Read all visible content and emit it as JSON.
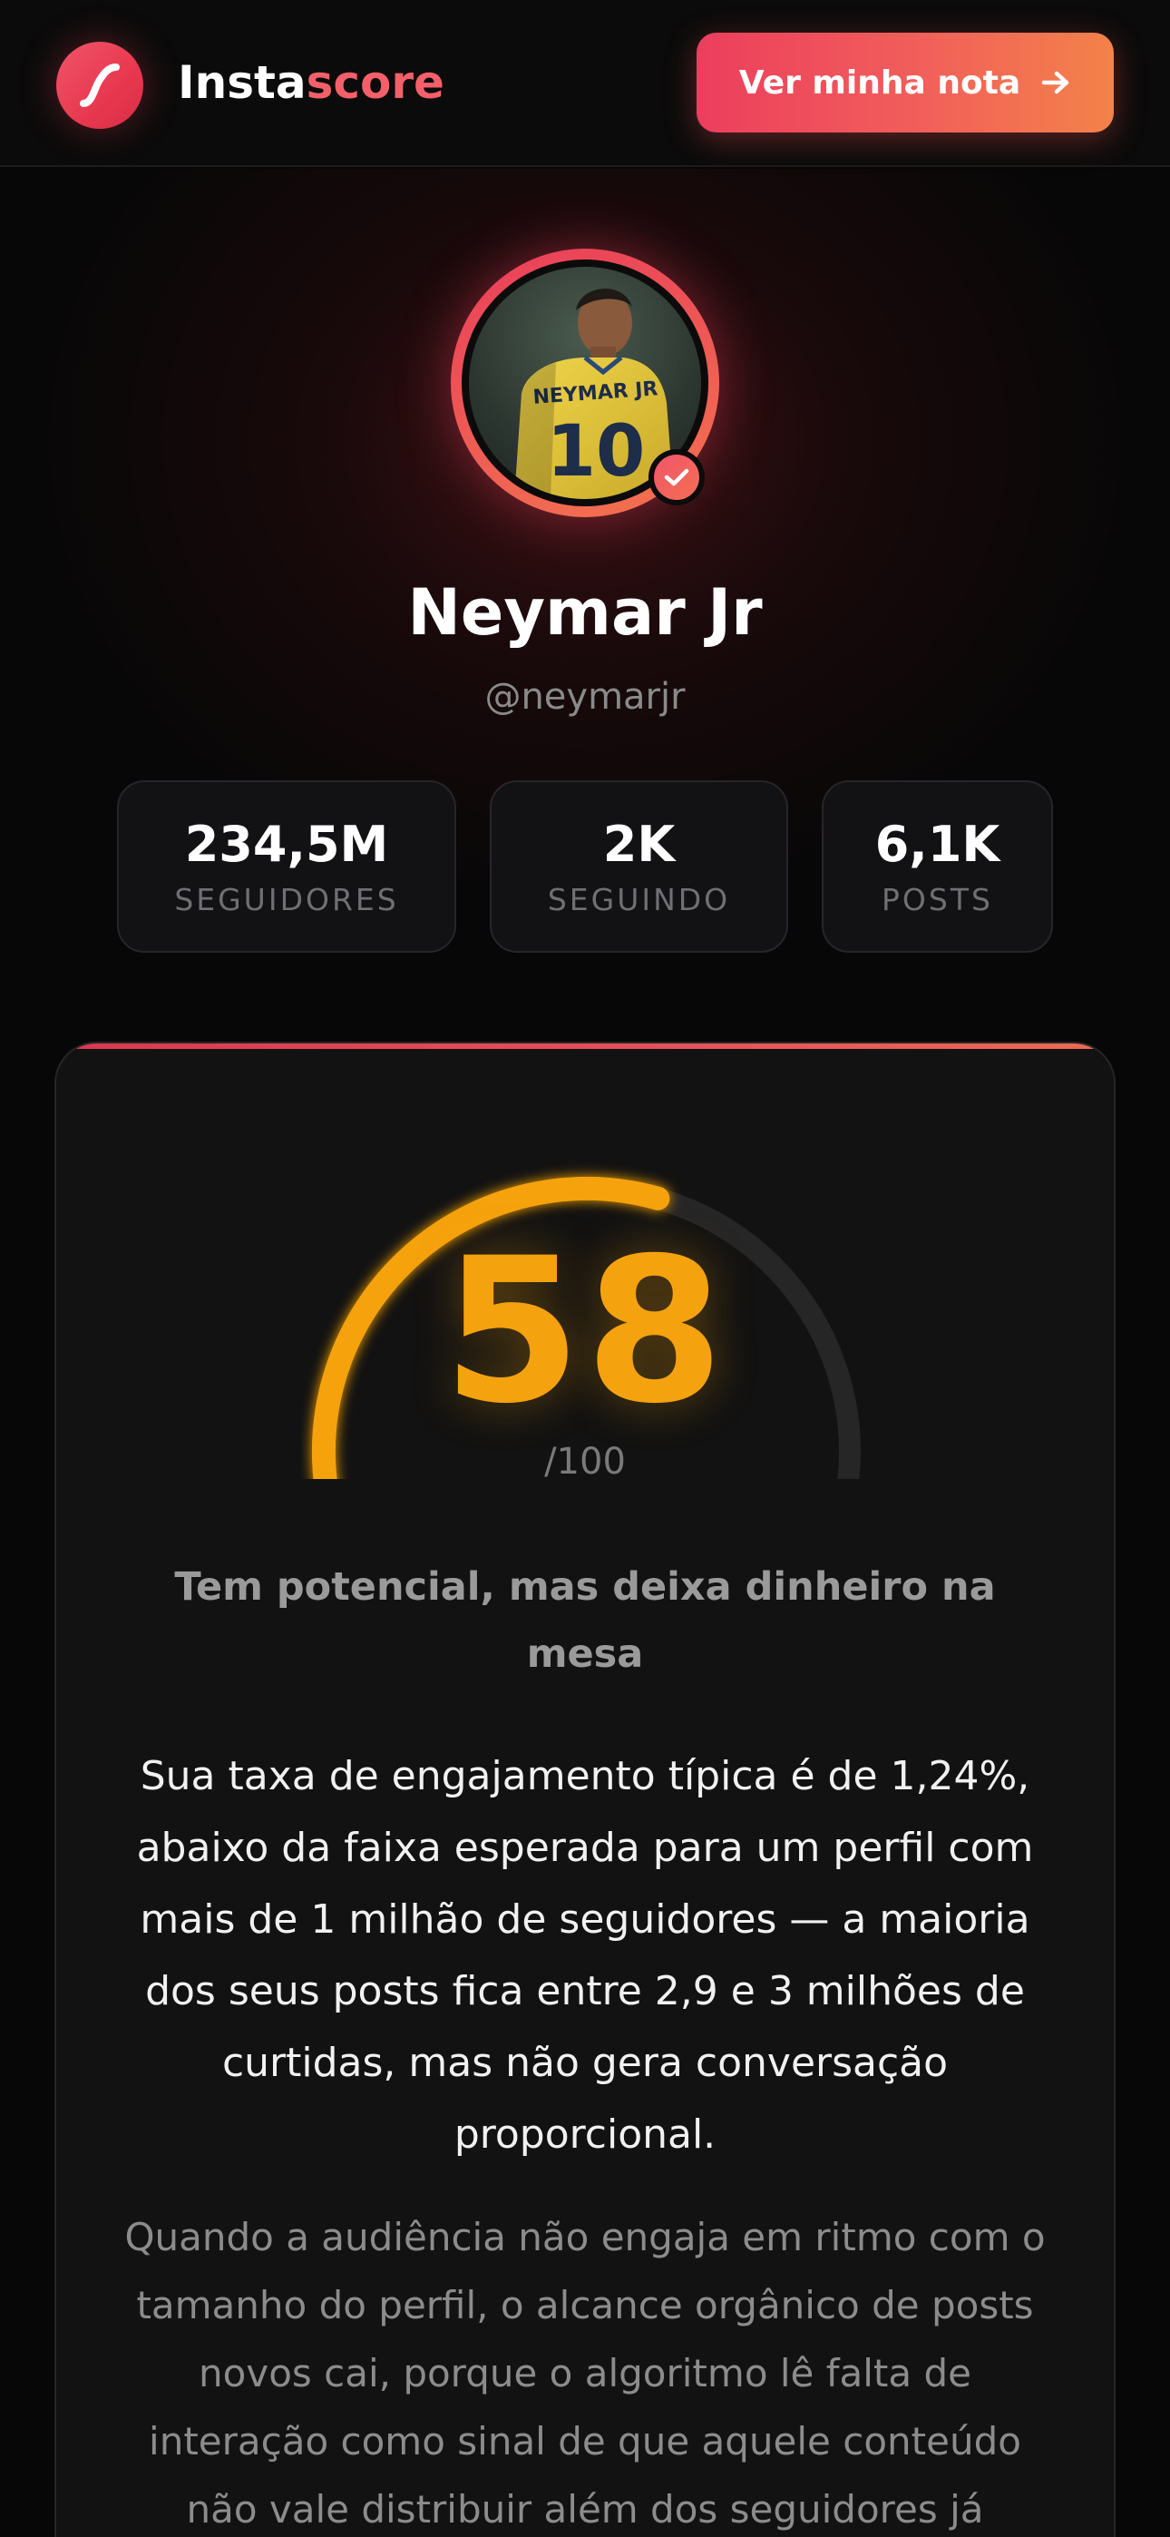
{
  "header": {
    "brand_part1": "Insta",
    "brand_part2": "score",
    "cta_label": "Ver minha nota",
    "logo_icon": "s-curve-logo-icon",
    "cta_icon": "arrow-right-icon"
  },
  "profile": {
    "name": "Neymar Jr",
    "handle": "@neymarjr",
    "avatar_jersey_text": "NEYMAR JR",
    "avatar_jersey_number": "10",
    "verified_icon": "check-icon",
    "stats": [
      {
        "value": "234,5M",
        "label": "SEGUIDORES"
      },
      {
        "value": "2K",
        "label": "SEGUINDO"
      },
      {
        "value": "6,1K",
        "label": "POSTS"
      }
    ]
  },
  "score_card": {
    "score": "58",
    "score_fraction": 0.58,
    "denominator": "/100",
    "verdict": "Tem potencial, mas deixa dinheiro na mesa",
    "paragraph1": "Sua taxa de engajamento típica é de 1,24%, abaixo da faixa esperada para um perfil com mais de 1 milhão de seguidores — a maioria dos seus posts fica entre 2,9 e 3 milhões de curtidas, mas não gera conversação proporcional.",
    "paragraph2": "Quando a audiência não engaja em ritmo com o tamanho do perfil, o alcance orgânico de posts novos cai, porque o algoritmo lê falta de interação como sinal de que aquele conteúdo não vale distribuir além dos seguidores já"
  },
  "colors": {
    "accent": "#ec3e5e",
    "accent_secondary": "#f3824a",
    "score": "#f5a20f",
    "background": "#070707",
    "card": "#121212"
  }
}
